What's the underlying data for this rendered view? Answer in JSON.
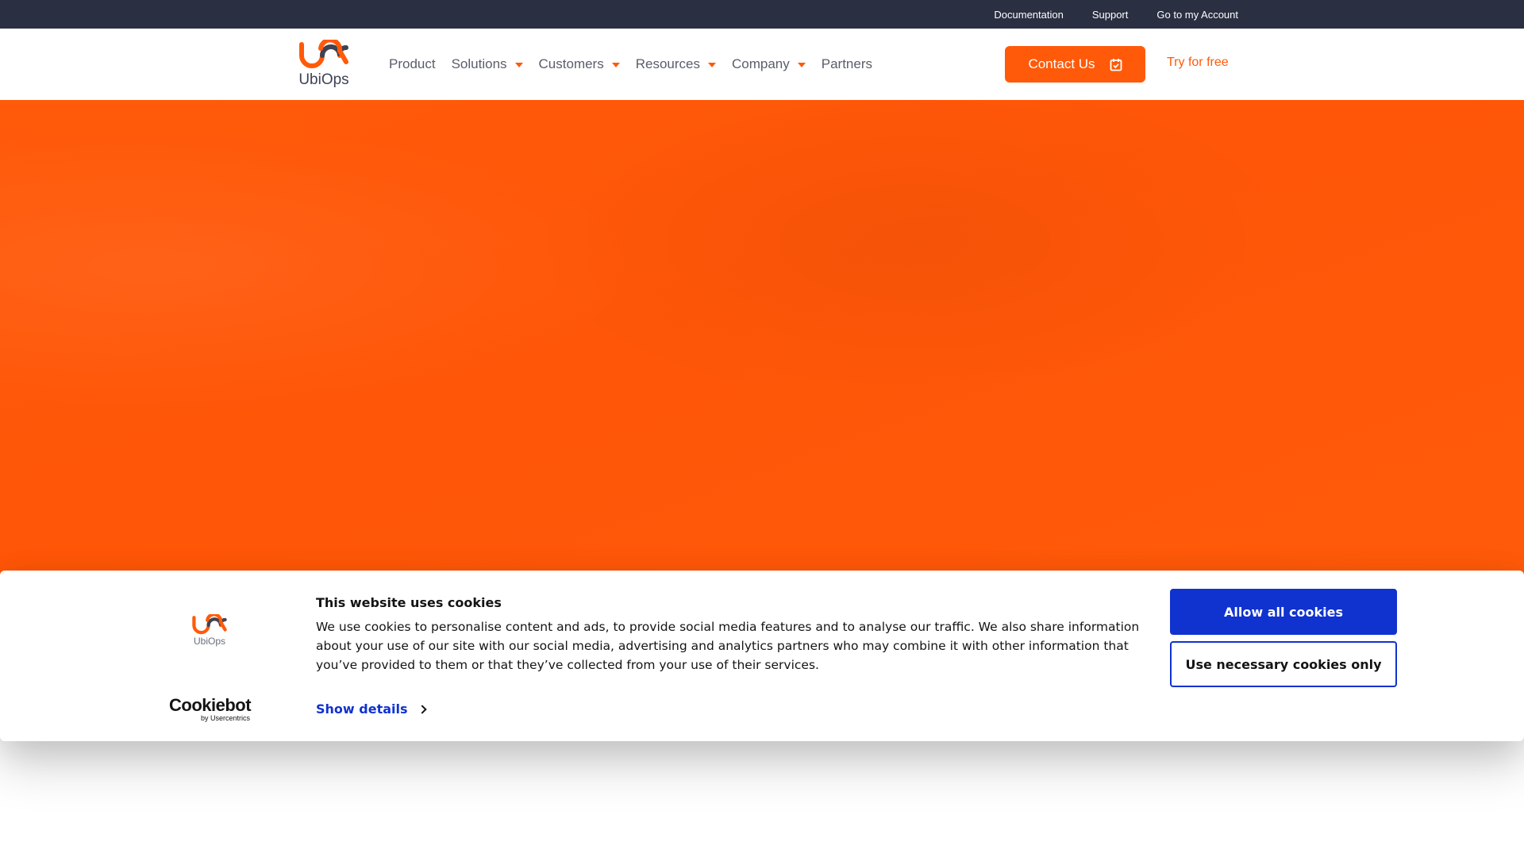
{
  "topbar": {
    "links": [
      "Documentation",
      "Support",
      "Go to my Account"
    ]
  },
  "brand": {
    "name": "UbiOps",
    "accent_color": "#ff5a0a",
    "dark_color": "#2b2f42"
  },
  "nav": {
    "items": [
      {
        "label": "Product",
        "has_dropdown": false
      },
      {
        "label": "Solutions",
        "has_dropdown": true
      },
      {
        "label": "Customers",
        "has_dropdown": true
      },
      {
        "label": "Resources",
        "has_dropdown": true
      },
      {
        "label": "Company",
        "has_dropdown": true
      },
      {
        "label": "Partners",
        "has_dropdown": false
      }
    ],
    "contact_label": "Contact Us",
    "contact_icon": "calendar-check-icon",
    "try_label": "Try for free"
  },
  "cookie_banner": {
    "title": "This website uses cookies",
    "text": "We use cookies to personalise content and ads, to provide social media features and to analyse our traffic. We also share information about your use of our site with our social media, advertising and analytics partners who may combine it with other information that you’ve provided to them or that they’ve collected from your use of their services.",
    "details_label": "Show details",
    "allow_label": "Allow all cookies",
    "necessary_label": "Use necessary cookies only",
    "logo_text": "UbiOps",
    "provider_name": "Cookiebot",
    "provider_sub": "by Usercentrics",
    "button_color": "#1032cf"
  }
}
